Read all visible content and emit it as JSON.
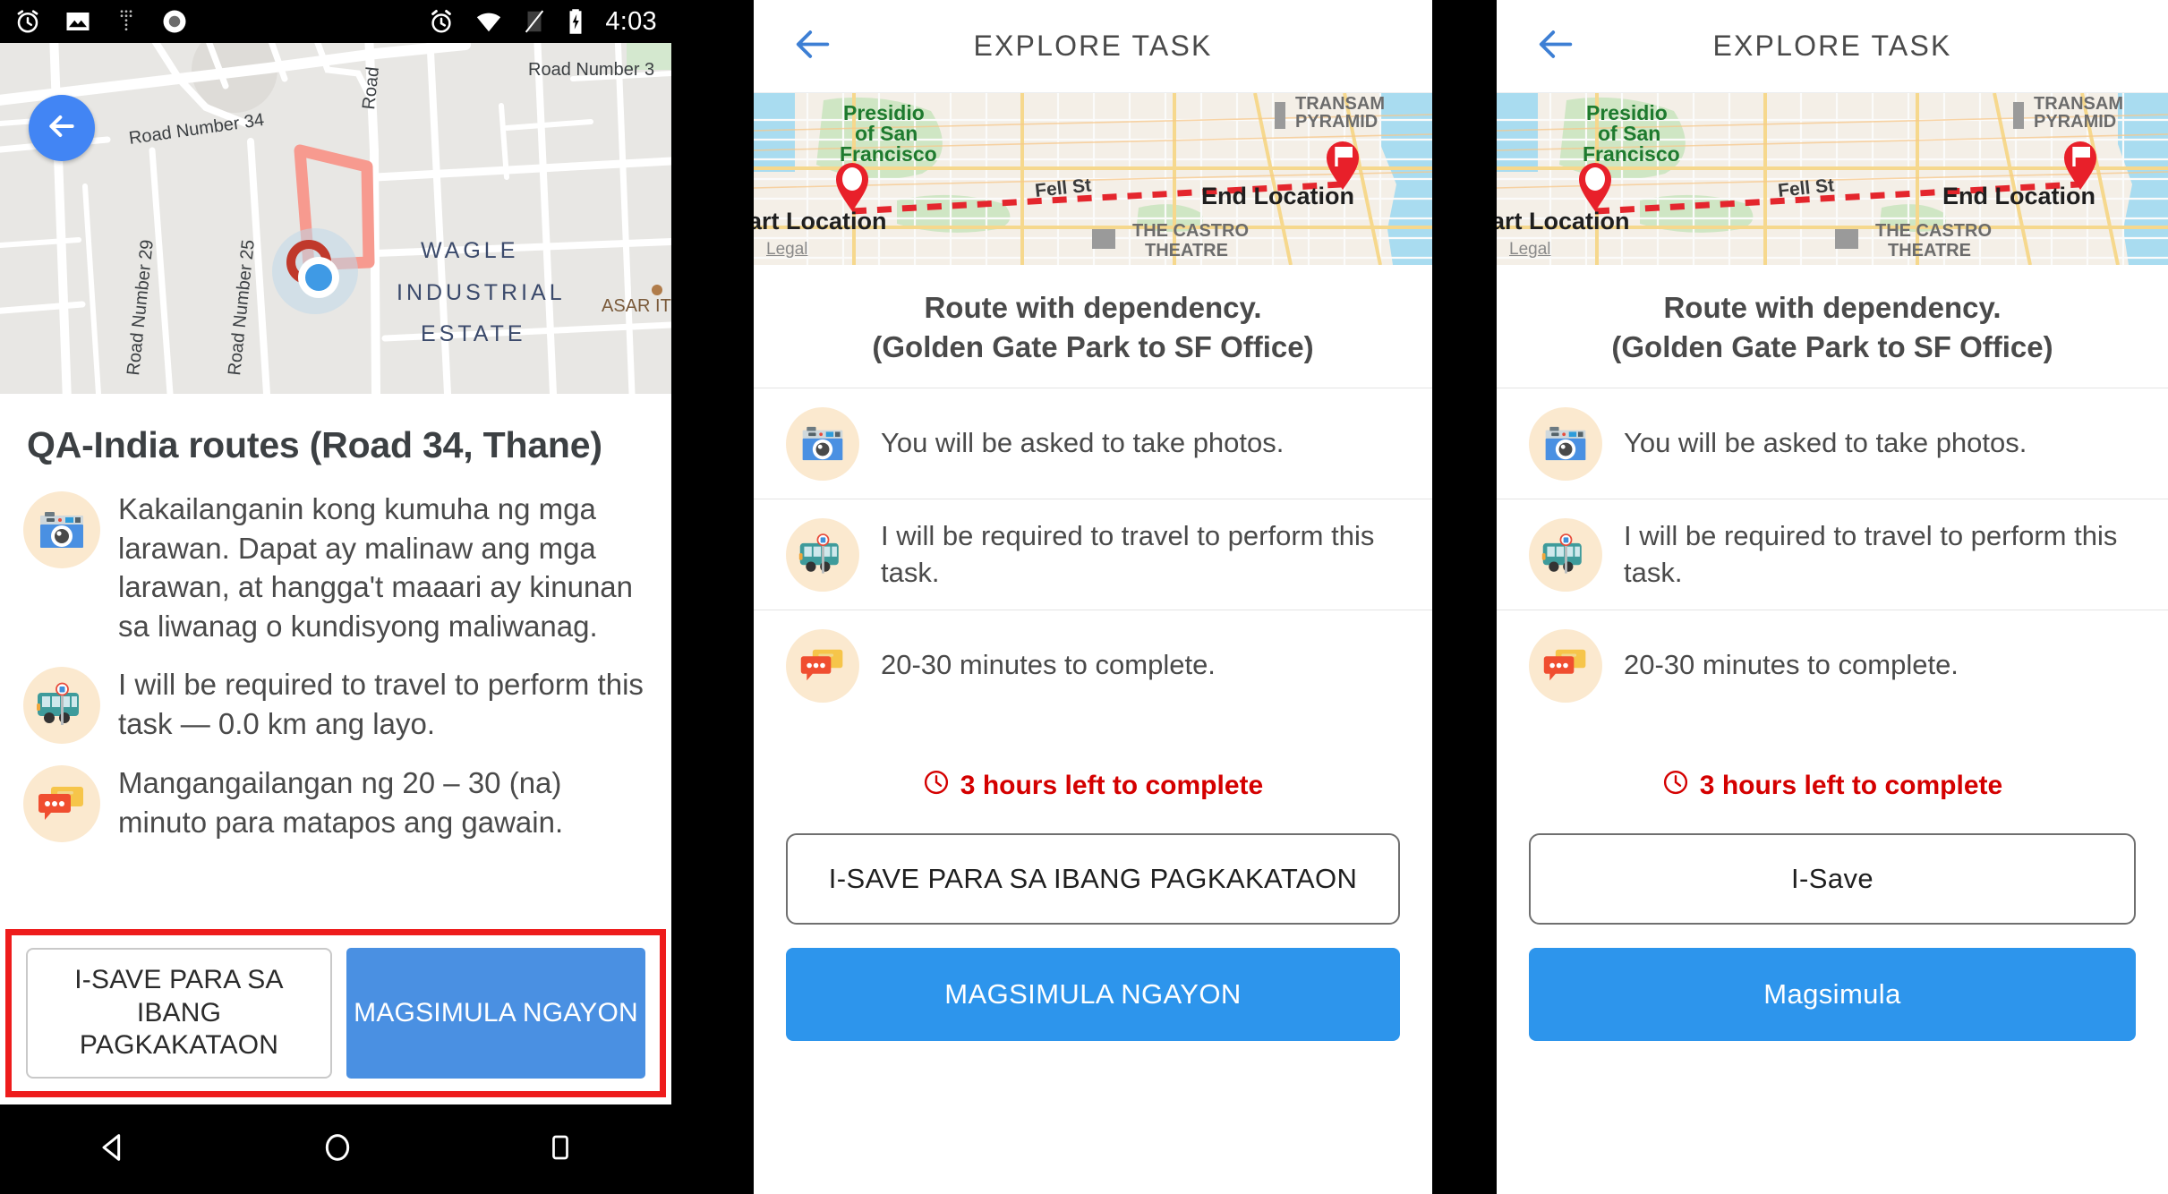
{
  "status_bar": {
    "icons_left": [
      "alarm-icon",
      "image-icon",
      "dots-icon",
      "record-icon"
    ],
    "icons_right": [
      "alarm-clock-icon",
      "wifi-icon",
      "sim-off-icon",
      "battery-charging-icon"
    ],
    "time": "4:03"
  },
  "nav_bar": {
    "back_label": "back-triangle-icon",
    "home_label": "home-circle-icon",
    "recents_label": "recents-square-icon"
  },
  "left_panel": {
    "map": {
      "roads": [
        "Road Number 34",
        "Road Number 29",
        "Road Number 25",
        "Road",
        "Road Number 3"
      ],
      "place_label_lines": [
        "WAGLE",
        "INDUSTRIAL",
        "ESTATE"
      ],
      "poi_label": "ASAR IT",
      "back_icon": "back-arrow-icon"
    },
    "title": "QA-India routes (Road 34, Thane)",
    "items": [
      {
        "icon": "camera-icon",
        "text": "Kakailanganin kong kumuha ng mga larawan. Dapat ay malinaw ang mga larawan, at hangga't maaari ay kinunan sa liwanag o kundisyong maliwanag."
      },
      {
        "icon": "bus-icon",
        "text": "I will be required to travel to perform this task — 0.0 km ang layo."
      },
      {
        "icon": "chat-icon",
        "text": "Mangangailangan ng 20 – 30 (na) minuto para matapos ang gawain."
      }
    ],
    "buttons": {
      "save_label": "I-SAVE PARA SA IBANG PAGKAKATAON",
      "start_label": "MAGSIMULA NGAYON"
    },
    "highlight_color": "#ee1c1c"
  },
  "mid_panel": {
    "app_bar": {
      "back_icon": "back-arrow-icon",
      "title": "EXPLORE TASK"
    },
    "map": {
      "labels": [
        "Presidio",
        "of San",
        "Francisco",
        "TRANSAMERICA",
        "PYRAMID",
        "Fell St",
        "Start Location",
        "End Location",
        "THE CASTRO",
        "THEATRE"
      ],
      "legal": "Legal",
      "start_marker": "start-pin-icon",
      "end_marker": "end-flag-pin-icon",
      "route_color": "#e4262d"
    },
    "title_line1": "Route with dependency.",
    "title_line2": "(Golden Gate Park to SF Office)",
    "items": [
      {
        "icon": "camera-icon",
        "text": "You will be asked to take photos."
      },
      {
        "icon": "bus-icon",
        "text": "I will be required to travel to perform this task."
      },
      {
        "icon": "chat-icon",
        "text": "20-30 minutes to complete."
      }
    ],
    "deadline": {
      "icon": "clock-icon",
      "text": "3 hours left to complete",
      "color": "#d40000"
    },
    "buttons": {
      "save_label": "I-SAVE PARA SA IBANG PAGKAKATAON",
      "start_label": "MAGSIMULA NGAYON"
    }
  },
  "right_panel": {
    "app_bar": {
      "back_icon": "back-arrow-icon",
      "title": "EXPLORE TASK"
    },
    "map": {
      "labels": [
        "Presidio",
        "of San",
        "Francisco",
        "TRANSAMERICA",
        "PYRAMID",
        "Fell St",
        "Start Location",
        "End Location",
        "THE CASTRO",
        "THEATRE"
      ],
      "legal": "Legal",
      "start_marker": "start-pin-icon",
      "end_marker": "end-flag-pin-icon",
      "route_color": "#e4262d"
    },
    "title_line1": "Route with dependency.",
    "title_line2": "(Golden Gate Park to SF Office)",
    "items": [
      {
        "icon": "camera-icon",
        "text": "You will be asked to take photos."
      },
      {
        "icon": "bus-icon",
        "text": "I will be required to travel to perform this task."
      },
      {
        "icon": "chat-icon",
        "text": "20-30 minutes to complete."
      }
    ],
    "deadline": {
      "icon": "clock-icon",
      "text": "3 hours left to complete",
      "color": "#d40000"
    },
    "buttons": {
      "save_label": "I-Save",
      "start_label": "Magsimula"
    }
  },
  "colors": {
    "primary_blue": "#2d95ec",
    "fab_blue": "#4285f4",
    "alert_red": "#d40000",
    "highlight_red": "#ee1c1c",
    "badge_peach": "#fbe9cf"
  }
}
